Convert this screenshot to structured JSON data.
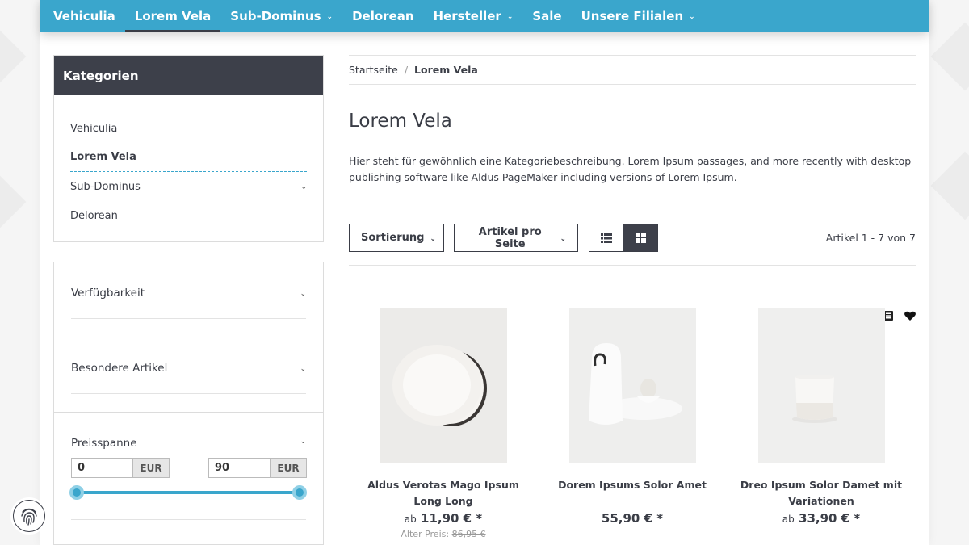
{
  "nav": {
    "items": [
      {
        "label": "Vehiculia"
      },
      {
        "label": "Lorem Vela"
      },
      {
        "label": "Sub-Dominus"
      },
      {
        "label": "Delorean"
      },
      {
        "label": "Hersteller"
      },
      {
        "label": "Sale"
      },
      {
        "label": "Unsere Filialen"
      }
    ]
  },
  "sidebar": {
    "title": "Kategorien",
    "categories": [
      {
        "label": "Vehiculia"
      },
      {
        "label": "Lorem Vela"
      },
      {
        "label": "Sub-Dominus"
      },
      {
        "label": "Delorean"
      }
    ],
    "filters": {
      "availability": "Verfügbarkeit",
      "special": "Besondere Artikel",
      "price": "Preisspanne",
      "price_min": "0",
      "price_max": "90",
      "currency": "EUR"
    }
  },
  "breadcrumb": {
    "home": "Startseite",
    "separator": "/",
    "current": "Lorem Vela"
  },
  "main": {
    "title": "Lorem Vela",
    "description": "Hier steht für gewöhnlich eine Kategoriebeschreibung. Lorem Ipsum passages, and more recently with desktop publishing software like Aldus PageMaker including versions of Lorem Ipsum.",
    "sort_label": "Sortierung",
    "per_page_label": "Artikel pro Seite",
    "article_count": "Artikel 1 - 7 von 7"
  },
  "products": [
    {
      "name": "Aldus Verotas Mago Ipsum Long Long",
      "price_prefix": "ab",
      "price": "11,90 € *",
      "old_label": "Alter Preis:",
      "old_price": "86,95 €"
    },
    {
      "name": "Dorem Ipsums Solor Amet",
      "price_prefix": "",
      "price": "55,90 € *"
    },
    {
      "name": "Dreo Ipsum Solor Damet mit Variationen",
      "price_prefix": "ab",
      "price": "33,90 € *"
    }
  ],
  "colors": {
    "accent": "#3aa6cc",
    "dark": "#3d404a"
  }
}
